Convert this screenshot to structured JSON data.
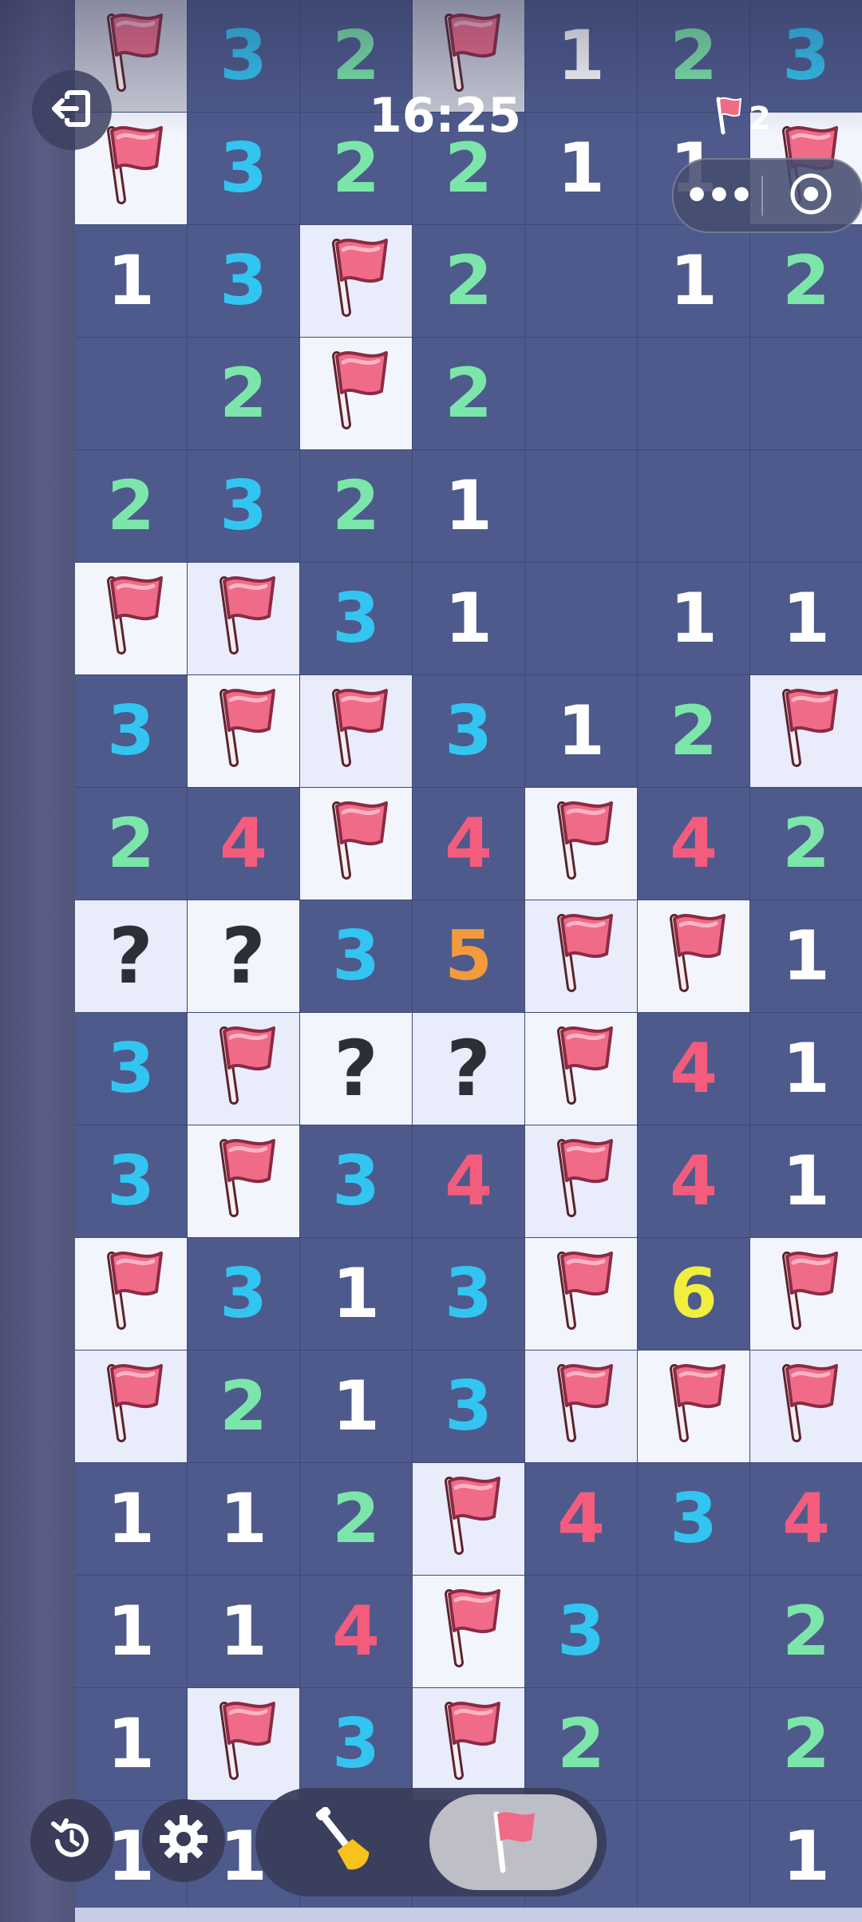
{
  "status": {
    "time": "16:25",
    "flags_left": "2"
  },
  "icons": {
    "exit": "exit-icon",
    "more": "more-icon",
    "target": "target-icon",
    "undo": "undo-icon",
    "settings": "gear-icon",
    "dig": "shovel-icon",
    "flag": "flag-icon"
  },
  "colors": {
    "n1": "#ffffff",
    "n2": "#7ce6aa",
    "n3": "#33c5f1",
    "n4": "#f45c7d",
    "n5": "#f39a3c",
    "n6": "#f0ee3f",
    "flag": "#f06b88",
    "covered": "#e8ecfb",
    "revealed": "#4e5a8c"
  },
  "grid": [
    [
      "F",
      "3",
      "2",
      "F",
      "1",
      "2",
      "3"
    ],
    [
      "F",
      "3",
      "2",
      "2",
      "1",
      "1",
      "F"
    ],
    [
      "1",
      "3",
      "F",
      "2",
      "",
      "1",
      "2"
    ],
    [
      "",
      "2",
      "F",
      "2",
      "",
      "",
      ""
    ],
    [
      "2",
      "3",
      "2",
      "1",
      "",
      "",
      ""
    ],
    [
      "F",
      "F",
      "3",
      "1",
      "",
      "1",
      "1"
    ],
    [
      "3",
      "F",
      "F",
      "3",
      "1",
      "2",
      "F"
    ],
    [
      "2",
      "4",
      "F",
      "4",
      "F",
      "4",
      "2"
    ],
    [
      "?",
      "?",
      "3",
      "5",
      "F",
      "F",
      "1"
    ],
    [
      "3",
      "F",
      "?",
      "?",
      "F",
      "4",
      "1"
    ],
    [
      "3",
      "F",
      "3",
      "4",
      "F",
      "4",
      "1"
    ],
    [
      "F",
      "3",
      "1",
      "3",
      "F",
      "6",
      "F"
    ],
    [
      "F",
      "2",
      "1",
      "3",
      "F",
      "F",
      "F"
    ],
    [
      "1",
      "1",
      "2",
      "F",
      "4",
      "3",
      "4"
    ],
    [
      "1",
      "1",
      "4",
      "F",
      "3",
      "",
      "2"
    ],
    [
      "1",
      "F",
      "3",
      "F",
      "2",
      "",
      "2"
    ],
    [
      "1",
      "1",
      "",
      "",
      "",
      "",
      "1"
    ]
  ]
}
